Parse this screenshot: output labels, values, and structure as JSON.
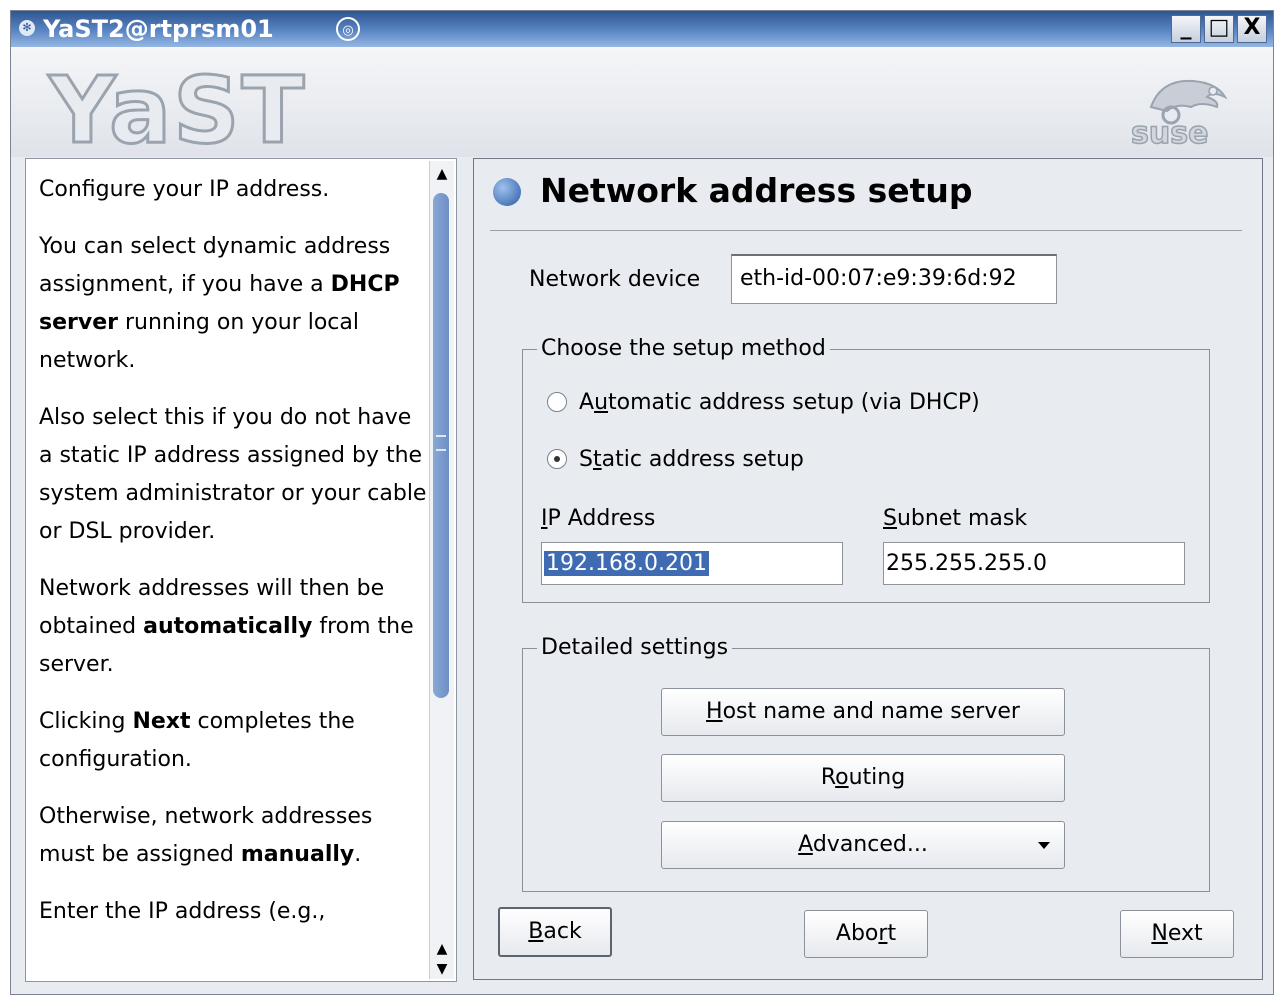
{
  "window": {
    "title": "YaST2@rtprsm01",
    "buttons": {
      "minimize": "_",
      "maximize": "□",
      "close": "X"
    }
  },
  "banner": {
    "logo_text": "YaST",
    "suse_logo_text": "suse"
  },
  "help": {
    "paragraphs": [
      {
        "text": "Configure your IP address."
      },
      {
        "parts": [
          "You can select dynamic address assignment, if you have a ",
          "DHCP server",
          " running on your local network."
        ]
      },
      {
        "text": "Also select this if you do not have a static IP address assigned by the system administrator or your cable or DSL provider."
      },
      {
        "parts": [
          "Network addresses will then be obtained ",
          "automatically",
          " from the server."
        ]
      },
      {
        "parts": [
          "Clicking ",
          "Next",
          " completes the configuration."
        ]
      },
      {
        "parts": [
          "Otherwise, network addresses must be assigned ",
          "manually",
          "."
        ]
      },
      {
        "text": "Enter the IP address (e.g.,"
      }
    ]
  },
  "main": {
    "title": "Network address setup",
    "device_label": "Network device",
    "device_value": "eth-id-00:07:e9:39:6d:92",
    "method_group": {
      "legend": "Choose the setup method",
      "options": [
        {
          "pre": "A",
          "ul": "u",
          "post": "tomatic address setup (via DHCP)",
          "selected": false
        },
        {
          "pre": "S",
          "ul": "t",
          "post": "atic address setup",
          "selected": true
        }
      ],
      "ip_label": {
        "ul": "I",
        "post": "P Address"
      },
      "ip_value": "192.168.0.201",
      "mask_label": {
        "ul": "S",
        "post": "ubnet mask"
      },
      "mask_value": "255.255.255.0"
    },
    "detail_group": {
      "legend": "Detailed settings",
      "host_button": {
        "ul": "H",
        "post": "ost name and name server"
      },
      "routing_button": {
        "pre": "R",
        "ul": "o",
        "post": "uting"
      },
      "advanced_button": {
        "ul": "A",
        "post": "dvanced..."
      }
    },
    "nav": {
      "back": {
        "ul": "B",
        "post": "ack"
      },
      "abort": {
        "pre": "Abo",
        "ul": "r",
        "post": "t"
      },
      "next": {
        "ul": "N",
        "post": "ext"
      }
    }
  }
}
